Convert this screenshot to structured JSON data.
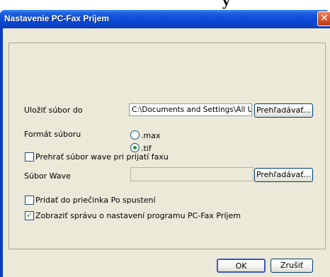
{
  "top_fragment": "у",
  "window": {
    "title": "Nastavenie PC-Fax Príjem",
    "close_glyph": "✕"
  },
  "save_location": {
    "label": "Uložiť súbor do",
    "path_value": "C:\\Documents and Settings\\All Use",
    "browse_label": "Prehľadávať..."
  },
  "file_format": {
    "label": "Formát súboru",
    "options": [
      {
        "label": ".max",
        "selected": false
      },
      {
        "label": ".tif",
        "selected": true
      }
    ]
  },
  "play_wave": {
    "label": "Prehrať súbor wave pri prijatí faxu",
    "checked": false
  },
  "wave_file": {
    "label": "Súbor Wave",
    "value": "",
    "browse_label": "Prehľadávať..."
  },
  "add_startup": {
    "label": "Pridať do priečinka Po spustení",
    "checked": false
  },
  "show_message": {
    "label": "Zobraziť správu o nastavení programu PC-Fax Príjem",
    "checked": true
  },
  "buttons": {
    "ok_label": "OK",
    "cancel_label": "Zrušiť"
  },
  "colors": {
    "titlebar": "#0a44c8",
    "check_mark": "#21a121",
    "dialog_bg": "#ece9d8"
  }
}
